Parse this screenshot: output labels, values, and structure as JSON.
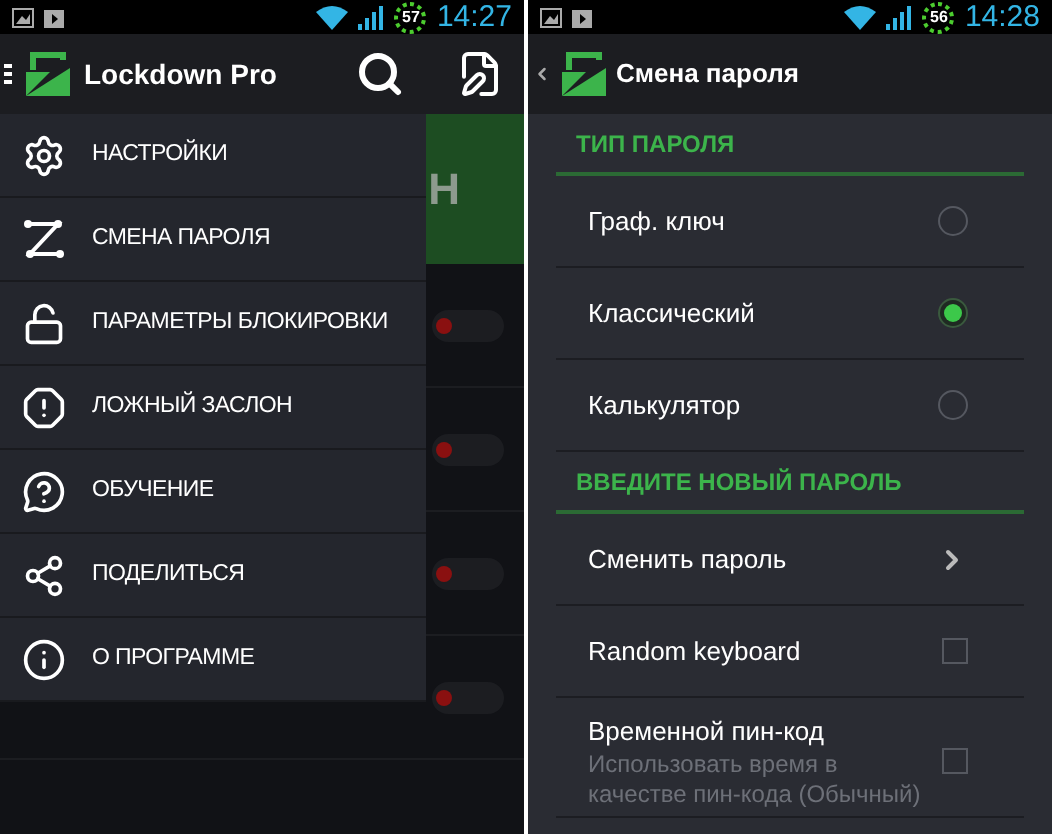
{
  "left": {
    "status_bar": {
      "battery": "57",
      "time": "14:27"
    },
    "app_bar": {
      "title": "Lockdown Pro"
    },
    "background": {
      "banner_text": "Н",
      "toggles": [
        {
          "on": false
        },
        {
          "on": false
        },
        {
          "on": false
        },
        {
          "on": false
        }
      ]
    },
    "drawer": {
      "items": [
        {
          "label": "НАСТРОЙКИ"
        },
        {
          "label": "СМЕНА ПАРОЛЯ"
        },
        {
          "label": "ПАРАМЕТРЫ БЛОКИРОВКИ"
        },
        {
          "label": "ЛОЖНЫЙ ЗАСЛОН"
        },
        {
          "label": "ОБУЧЕНИЕ"
        },
        {
          "label": "ПОДЕЛИТЬСЯ"
        },
        {
          "label": "О ПРОГРАММЕ"
        }
      ]
    }
  },
  "right": {
    "status_bar": {
      "battery": "56",
      "time": "14:28"
    },
    "app_bar": {
      "title": "Смена пароля"
    },
    "sections": [
      {
        "header": "ТИП ПАРОЛЯ",
        "rows": [
          {
            "kind": "radio",
            "label": "Граф. ключ",
            "selected": false
          },
          {
            "kind": "radio",
            "label": "Классический",
            "selected": true
          },
          {
            "kind": "radio",
            "label": "Калькулятор",
            "selected": false
          }
        ]
      },
      {
        "header": "ВВЕДИТЕ НОВЫЙ ПАРОЛЬ",
        "rows": [
          {
            "kind": "link",
            "label": "Сменить пароль"
          },
          {
            "kind": "checkbox",
            "label": "Random keyboard",
            "checked": false
          },
          {
            "kind": "checkbox",
            "label": "Временной пин-код",
            "summary": "Использовать время в качестве пин-кода (Обычный)",
            "checked": false
          }
        ]
      }
    ]
  }
}
